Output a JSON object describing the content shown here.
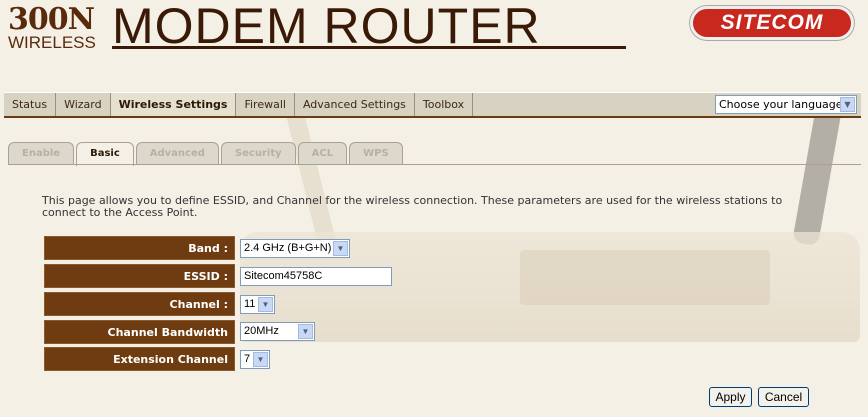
{
  "header": {
    "logo_300n": "300N",
    "logo_wireless": "WIRELESS",
    "title": "MODEM ROUTER",
    "brand": "SITECOM"
  },
  "nav": {
    "items": [
      {
        "label": "Status"
      },
      {
        "label": "Wizard"
      },
      {
        "label": "Wireless Settings",
        "active": true
      },
      {
        "label": "Firewall"
      },
      {
        "label": "Advanced Settings"
      },
      {
        "label": "Toolbox"
      }
    ],
    "language_select": "Choose your language"
  },
  "subtabs": [
    {
      "label": "Enable"
    },
    {
      "label": "Basic",
      "active": true
    },
    {
      "label": "Advanced"
    },
    {
      "label": "Security"
    },
    {
      "label": "ACL"
    },
    {
      "label": "WPS"
    }
  ],
  "description": "This page allows you to define ESSID, and Channel for the wireless connection. These parameters are used for the wireless stations to connect to the Access Point.",
  "form": {
    "band": {
      "label": "Band :",
      "value": "2.4 GHz (B+G+N)"
    },
    "essid": {
      "label": "ESSID :",
      "value": "Sitecom45758C"
    },
    "channel": {
      "label": "Channel :",
      "value": "11"
    },
    "bandwidth": {
      "label": "Channel Bandwidth",
      "value": "20MHz"
    },
    "extension": {
      "label": "Extension Channel",
      "value": "7"
    }
  },
  "buttons": {
    "apply": "Apply",
    "cancel": "Cancel"
  },
  "colors": {
    "label_bg": "#6e3c10",
    "brand_red": "#c8281e",
    "page_bg": "#f5f0e6"
  }
}
